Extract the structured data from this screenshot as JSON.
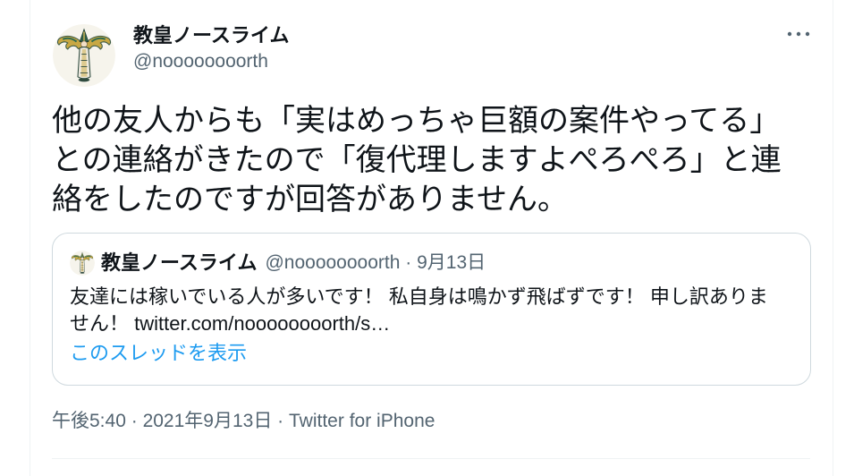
{
  "tweet": {
    "author": {
      "name": "教皇ノースライム",
      "handle": "@noooooooorth",
      "avatar_icon": "pope-character-avatar"
    },
    "more_icon": "more-horizontal-icon",
    "text_lines": [
      "他の友人からも「実はめっちゃ巨額の案件やってる」",
      "との連絡がきたので「復代理しますよぺろぺろ」と連",
      "絡をしたのですが回答がありません。"
    ],
    "quoted_tweet": {
      "author": {
        "name": "教皇ノースライム",
        "handle": "@noooooooorth",
        "avatar_icon": "pope-character-avatar"
      },
      "separator": "·",
      "date": "9月13日",
      "text_lines": [
        "友達には稼いでいる人が多いです！ 私自身は鳴かず飛ばずです！ 申し訳ありま",
        "せん！ twitter.com/noooooooorth/s…"
      ],
      "show_thread_label": "このスレッドを表示"
    },
    "timestamp": {
      "time": "午後5:40",
      "separator": "·",
      "date": "2021年9月13日",
      "source": "Twitter for iPhone"
    }
  },
  "colors": {
    "text": "#0f1419",
    "secondary_text": "#536471",
    "link": "#1d9bf0",
    "border": "#cfd9de",
    "divider": "#eff3f4"
  }
}
